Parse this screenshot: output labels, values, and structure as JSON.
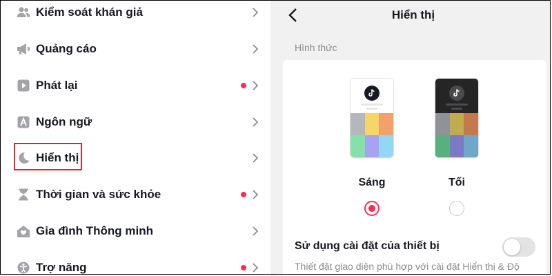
{
  "settings_menu": {
    "items": [
      {
        "label": "Kiểm soát khán giả",
        "icon": "people-icon",
        "dot": false
      },
      {
        "label": "Quảng cáo",
        "icon": "megaphone-icon",
        "dot": false
      },
      {
        "label": "Phát lại",
        "icon": "play-icon",
        "dot": true
      },
      {
        "label": "Ngôn ngữ",
        "icon": "language-icon",
        "dot": false
      },
      {
        "label": "Hiển thị",
        "icon": "moon-icon",
        "dot": false,
        "highlighted": true
      },
      {
        "label": "Thời gian và sức khỏe",
        "icon": "hourglass-icon",
        "dot": true
      },
      {
        "label": "Gia đình Thông minh",
        "icon": "home-heart-icon",
        "dot": false
      },
      {
        "label": "Trợ năng",
        "icon": "accessibility-icon",
        "dot": true
      }
    ]
  },
  "display_page": {
    "title": "Hiển thị",
    "section_label": "Hình thức",
    "options": [
      {
        "label": "Sáng",
        "selected": true
      },
      {
        "label": "Tối",
        "selected": false
      }
    ],
    "device_setting_label": "Sử dụng cài đặt của thiết bị",
    "device_setting_on": false,
    "device_setting_desc": "Thiết đặt giao diện phù hợp với cài đặt Hiển thị & Độ"
  },
  "colors": {
    "accent": "#fe2c55",
    "highlight_box": "#e0242a",
    "icon_gray": "#a3a4a9",
    "light_tiles": [
      "#b4b7bc",
      "#f6d66a",
      "#f3a06b",
      "#86e0a9",
      "#a8a2f2",
      "#93d7f6"
    ],
    "dark_tiles": [
      "#8f9296",
      "#c2ab4f",
      "#c47a4c",
      "#57b07e",
      "#7c79c4",
      "#6fa7c8"
    ]
  }
}
